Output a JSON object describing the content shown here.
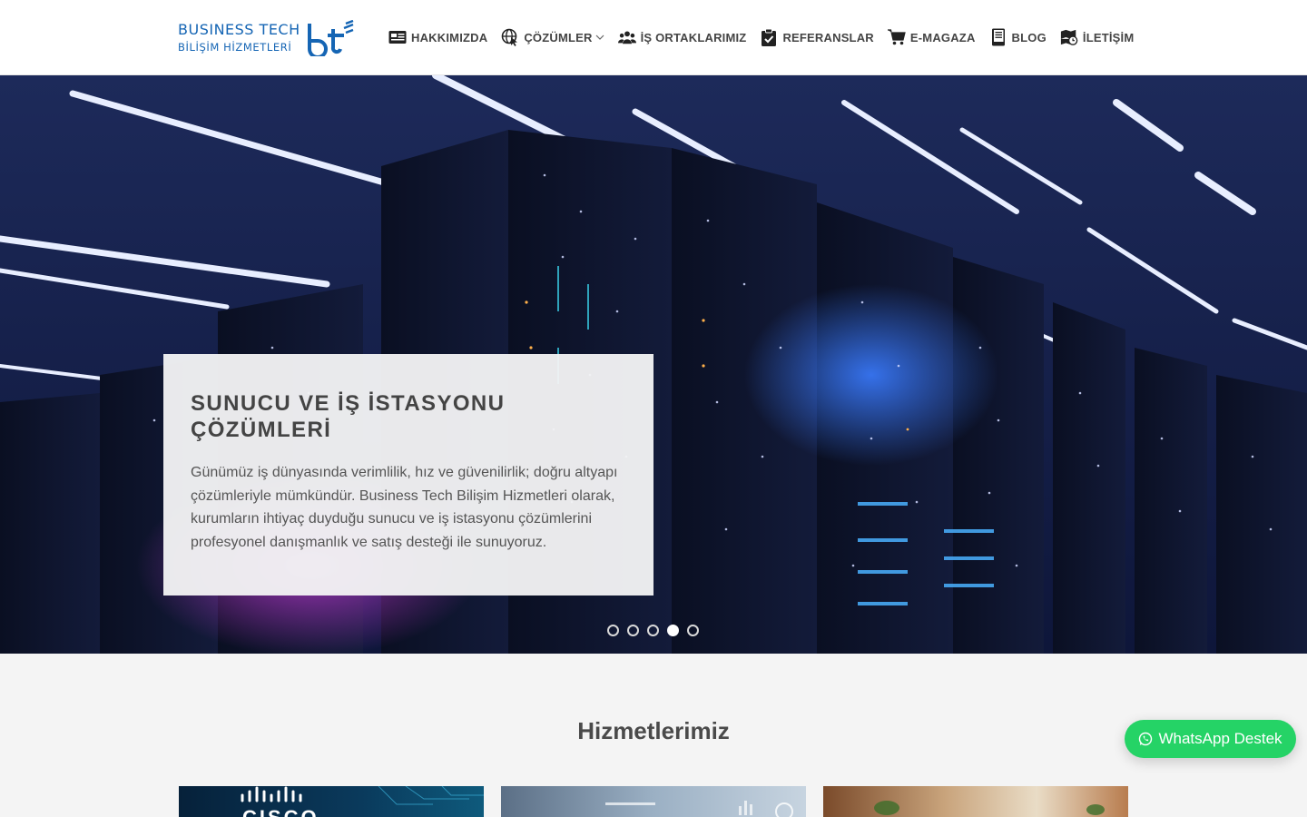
{
  "brand": {
    "line1": "BUSINESS TECH",
    "line2": "BİLİŞİM HİZMETLERİ",
    "mark": "bt",
    "color": "#1565b4"
  },
  "nav": {
    "items": [
      {
        "label": "HAKKIMIZDA",
        "icon": "newspaper-icon"
      },
      {
        "label": "ÇÖZÜMLER",
        "icon": "globe-pointer-icon",
        "has_dropdown": true
      },
      {
        "label": "İŞ ORTAKLARIMIZ",
        "icon": "users-icon"
      },
      {
        "label": "REFERANSLAR",
        "icon": "clipboard-check-icon"
      },
      {
        "label": "E-MAGAZA",
        "icon": "cart-icon"
      },
      {
        "label": "BLOG",
        "icon": "book-icon"
      },
      {
        "label": "İLETİŞİM",
        "icon": "contact-map-icon"
      }
    ]
  },
  "hero": {
    "title": "SUNUCU VE İŞ İSTASYONU ÇÖZÜMLERİ",
    "text": "Günümüz iş dünyasında verimlilik, hız ve güvenilirlik; doğru altyapı çözümleriyle mümkündür. Business Tech Bilişim Hizmetleri olarak, kurumların ihtiyaç duyduğu sunucu ve iş istasyonu çözümlerini profesyonel danışmanlık ve satış desteği ile sunuyoruz.",
    "slides_total": 5,
    "active_slide": 4
  },
  "services": {
    "title": "Hizmetlerimiz",
    "cards": [
      {
        "brand": "CISCO"
      },
      {
        "brand": ""
      },
      {
        "brand": ""
      }
    ]
  },
  "whatsapp": {
    "label": "WhatsApp Destek",
    "color": "#25d366"
  }
}
